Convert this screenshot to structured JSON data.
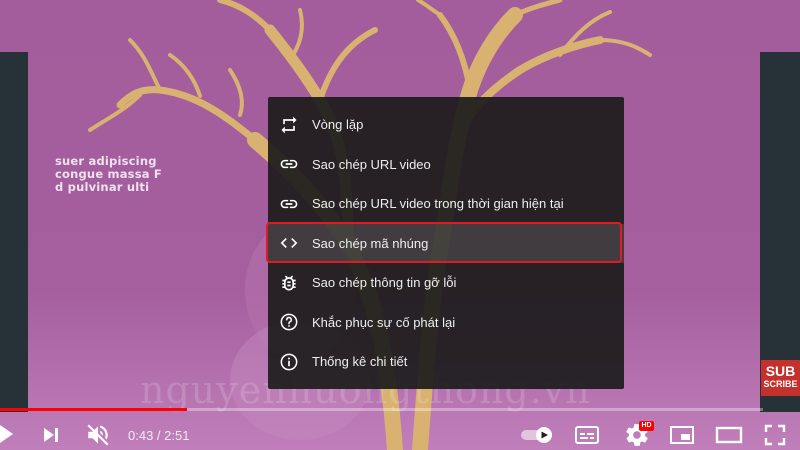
{
  "video": {
    "background_color": "#a35d9c",
    "background_text_lines": [
      "suer adipiscing",
      "congue massa F",
      "d pulvinar ulti"
    ],
    "watermark": "nguyenhuongthong.vn"
  },
  "subscribe": {
    "line1": "SUB",
    "line2": "SCRIBE"
  },
  "context_menu": {
    "items": [
      {
        "label": "Vòng lặp",
        "icon": "loop-icon"
      },
      {
        "label": "Sao chép URL video",
        "icon": "link-icon"
      },
      {
        "label": "Sao chép URL video trong thời gian hiện tại",
        "icon": "link-icon"
      },
      {
        "label": "Sao chép mã nhúng",
        "icon": "code-icon",
        "highlighted": true
      },
      {
        "label": "Sao chép thông tin gỡ lỗi",
        "icon": "bug-icon"
      },
      {
        "label": "Khắc phục sự cố phát lại",
        "icon": "help-icon"
      },
      {
        "label": "Thống kê chi tiết",
        "icon": "info-icon"
      }
    ]
  },
  "controls": {
    "current_time": "0:43",
    "separator": " / ",
    "duration": "2:51",
    "progress_fraction": 0.245,
    "quality_badge": "HD",
    "accent_color": "#ff0000",
    "icons": [
      "play-icon",
      "next-icon",
      "mute-icon",
      "autoplay-toggle-icon",
      "subtitles-icon",
      "settings-icon",
      "miniplayer-icon",
      "theater-icon",
      "fullscreen-icon"
    ]
  }
}
